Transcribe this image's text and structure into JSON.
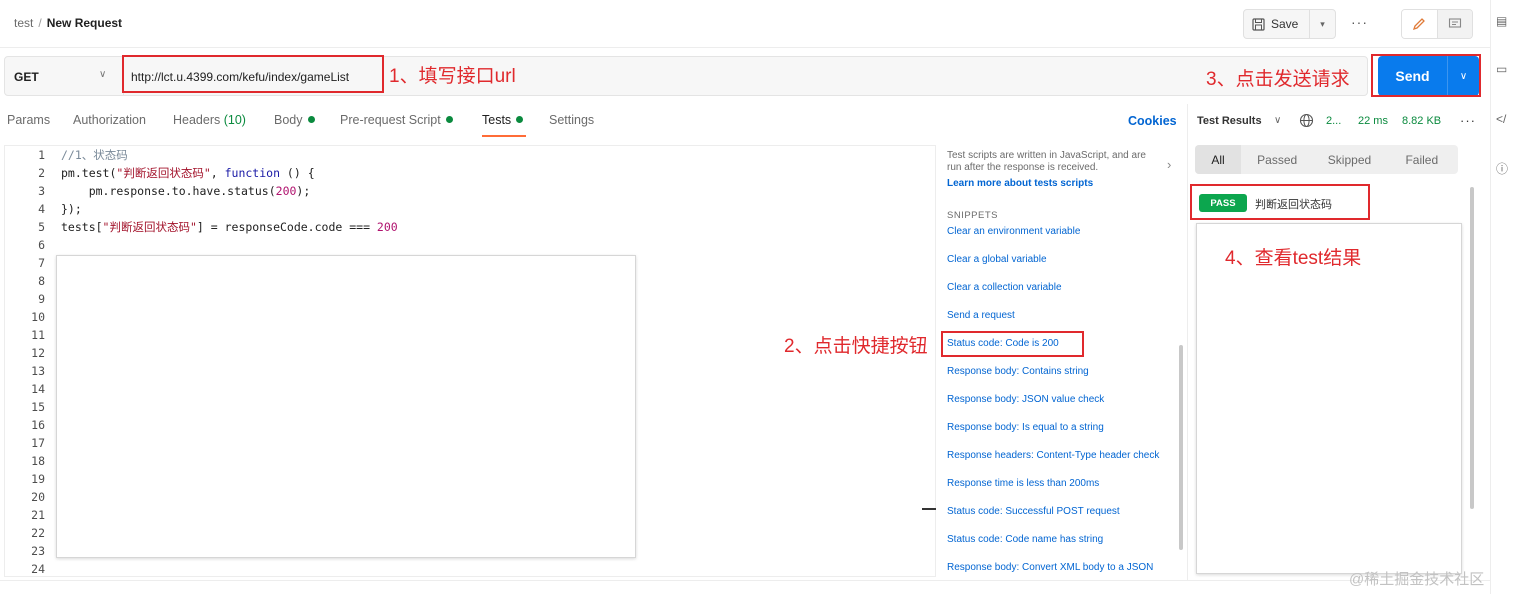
{
  "breadcrumb": {
    "collection": "test",
    "separator": "/",
    "request": "New Request"
  },
  "toolbar": {
    "save_label": "Save",
    "more": "···"
  },
  "request": {
    "method": "GET",
    "url": "http://lct.u.4399.com/kefu/index/gameList",
    "send_label": "Send"
  },
  "tabs": {
    "params": "Params",
    "authorization": "Authorization",
    "headers": "Headers",
    "headers_count": "(10)",
    "body": "Body",
    "prerequest": "Pre-request Script",
    "tests": "Tests",
    "settings": "Settings",
    "cookies": "Cookies"
  },
  "editor": {
    "line_numbers": [
      "1",
      "2",
      "3",
      "4",
      "5",
      "6",
      "7",
      "8",
      "9",
      "10",
      "11",
      "12",
      "13",
      "14",
      "15",
      "16",
      "17",
      "18",
      "19",
      "20",
      "21",
      "22",
      "23",
      "24"
    ],
    "l1": "//1、状态码",
    "l2a": "pm.test(",
    "l2b": "\"判断返回状态码\"",
    "l2c": ", ",
    "l2d": "function",
    "l2e": " () {",
    "l3a": "    pm.response.to.have.status(",
    "l3b": "200",
    "l3c": ");",
    "l4": "});",
    "l5a": "tests[",
    "l5b": "\"判断返回状态码\"",
    "l5c": "] = responseCode.code === ",
    "l5d": "200"
  },
  "snippets": {
    "info": "Test scripts are written in JavaScript, and are run after the response is received.",
    "learn": "Learn more about tests scripts",
    "heading": "SNIPPETS",
    "items": [
      "Clear an environment variable",
      "Clear a global variable",
      "Clear a collection variable",
      "Send a request",
      "Status code: Code is 200",
      "Response body: Contains string",
      "Response body: JSON value check",
      "Response body: Is equal to a string",
      "Response headers: Content-Type header check",
      "Response time is less than 200ms",
      "Status code: Successful POST request",
      "Status code: Code name has string",
      "Response body: Convert XML body to a JSON"
    ]
  },
  "response": {
    "title": "Test Results",
    "status": "2...",
    "time": "22 ms",
    "size": "8.82 KB",
    "more": "···",
    "filters": [
      "All",
      "Passed",
      "Skipped",
      "Failed"
    ],
    "result_badge": "PASS",
    "result_name": "判断返回状态码"
  },
  "annotations": {
    "n1": "1、填写接口url",
    "n2": "2、点击快捷按钮",
    "n3": "3、点击发送请求",
    "n4": "4、查看test结果",
    "color": "#e0292d"
  },
  "watermark": "@稀土掘金技术社区",
  "colors": {
    "send": "#097bed",
    "pass": "#0ca64e",
    "link": "#0265d2",
    "active_tab": "#ff6c37"
  }
}
